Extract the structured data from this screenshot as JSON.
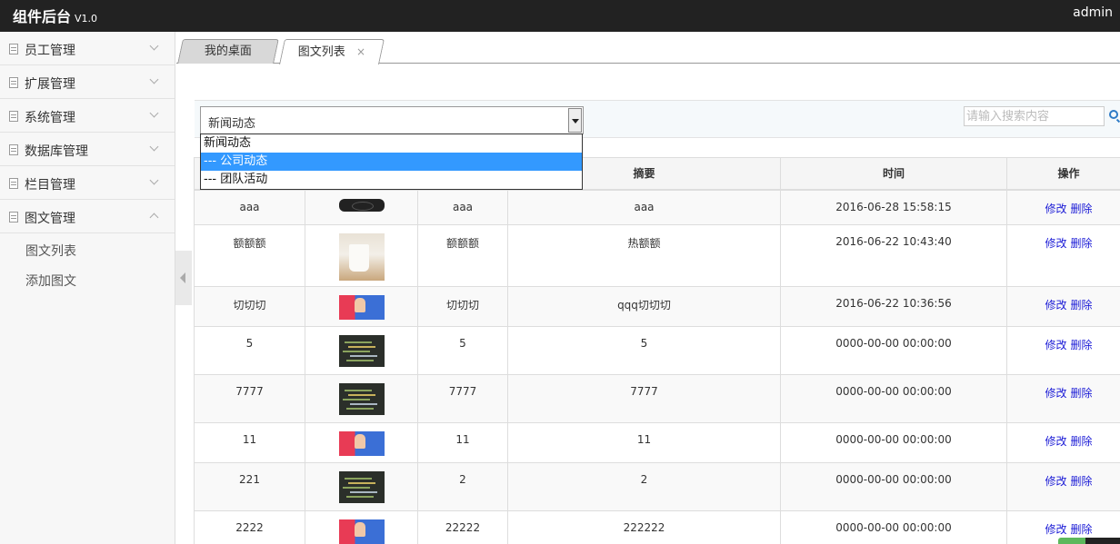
{
  "app": {
    "title": "组件后台",
    "version": "V1.0",
    "user": "admin"
  },
  "sidebar": {
    "menu": [
      {
        "label": "员工管理"
      },
      {
        "label": "扩展管理"
      },
      {
        "label": "系统管理"
      },
      {
        "label": "数据库管理"
      },
      {
        "label": "栏目管理"
      },
      {
        "label": "图文管理"
      }
    ],
    "submenu": [
      {
        "label": "图文列表"
      },
      {
        "label": "添加图文"
      }
    ]
  },
  "tabs": {
    "home": "我的桌面",
    "active": "图文列表",
    "close": "×"
  },
  "filter": {
    "selected": "新闻动态",
    "options": [
      "新闻动态",
      "--- 公司动态",
      "--- 团队活动"
    ],
    "search_placeholder": "请输入搜索内容"
  },
  "table": {
    "headers": [
      "",
      "",
      "",
      "摘要",
      "时间",
      "操作"
    ],
    "edit_label": "修改",
    "delete_label": "删除",
    "rows": [
      {
        "title": "aaa",
        "image": "dark-logo",
        "name": "aaa",
        "summary": "aaa",
        "time": "2016-06-28 15:58:15"
      },
      {
        "title": "额额额",
        "image": "mug-photo",
        "name": "额额额",
        "summary": "热额额",
        "time": "2016-06-22 10:43:40"
      },
      {
        "title": "切切切",
        "image": "person-banner",
        "name": "切切切",
        "summary": "qqq切切切",
        "time": "2016-06-22 10:36:56"
      },
      {
        "title": "5",
        "image": "code-screenshot",
        "name": "5",
        "summary": "5",
        "time": "0000-00-00 00:00:00"
      },
      {
        "title": "7777",
        "image": "code-screenshot",
        "name": "7777",
        "summary": "7777",
        "time": "0000-00-00 00:00:00"
      },
      {
        "title": "11",
        "image": "person-banner",
        "name": "11",
        "summary": "11",
        "time": "0000-00-00 00:00:00"
      },
      {
        "title": "221",
        "image": "code-screenshot",
        "name": "2",
        "summary": "2",
        "time": "0000-00-00 00:00:00"
      },
      {
        "title": "2222",
        "image": "person-banner",
        "name": "22222",
        "summary": "222222",
        "time": "0000-00-00 00:00:00"
      }
    ]
  }
}
